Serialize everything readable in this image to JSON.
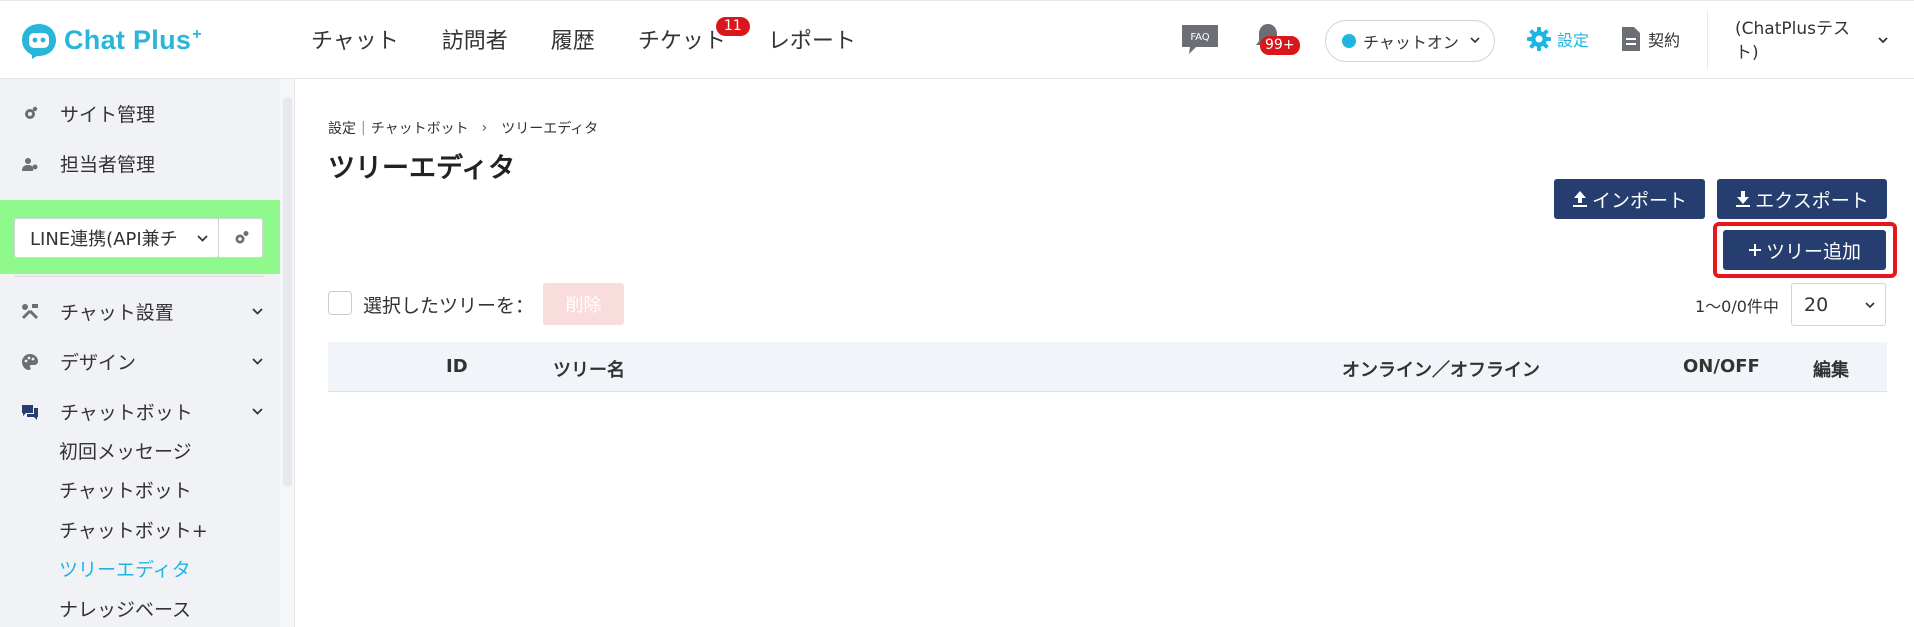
{
  "header": {
    "logo_text": "Chat Plus",
    "logo_sup": "+",
    "nav": [
      {
        "label": "チャット"
      },
      {
        "label": "訪問者"
      },
      {
        "label": "履歴"
      },
      {
        "label": "チケット",
        "badge": "11"
      },
      {
        "label": "レポート"
      }
    ],
    "faq_label": "FAQ",
    "notifications_badge": "99+",
    "status_select": "チャットオン",
    "settings_label": "設定",
    "contract_label": "契約",
    "user_name": "(ChatPlusテスト)",
    "colors": {
      "brand": "#29b6d8",
      "accent": "#1fb5e3",
      "badge": "#d9161c"
    }
  },
  "sidebar": {
    "top_items": [
      {
        "label": "サイト管理",
        "icon": "gear-icon"
      },
      {
        "label": "担当者管理",
        "icon": "user-gear-icon"
      }
    ],
    "site_select": "LINE連携(API兼チ",
    "sections": [
      {
        "label": "チャット設置",
        "icon": "tools-icon"
      },
      {
        "label": "デザイン",
        "icon": "palette-icon"
      },
      {
        "label": "チャットボット",
        "icon": "chat-icon"
      }
    ],
    "chatbot_sub": [
      {
        "label": "初回メッセージ"
      },
      {
        "label": "チャットボット"
      },
      {
        "label": "チャットボット+"
      },
      {
        "label": "ツリーエディタ",
        "active": true
      },
      {
        "label": "ナレッジベース"
      }
    ]
  },
  "main": {
    "breadcrumb": [
      "設定",
      "チャットボット",
      "ツリーエディタ"
    ],
    "title": "ツリーエディタ",
    "import_label": "インポート",
    "export_label": "エクスポート",
    "add_tree_label": "ツリー追加",
    "selected_label": "選択したツリーを：",
    "delete_label": "削除",
    "count_label": "1〜0/0件中",
    "per_page": "20",
    "table_headers": [
      "ID",
      "ツリー名",
      "オンライン／オフライン",
      "ON/OFF",
      "編集"
    ]
  }
}
